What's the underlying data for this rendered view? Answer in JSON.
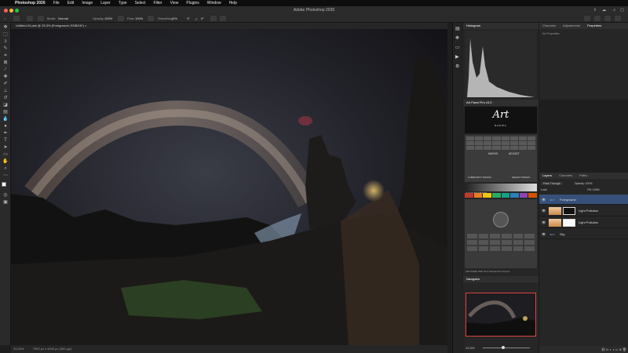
{
  "menubar": {
    "apple": "",
    "items": [
      "Photoshop 2026",
      "File",
      "Edit",
      "Image",
      "Layer",
      "Type",
      "Select",
      "Filter",
      "View",
      "Plugins",
      "Window",
      "Help"
    ]
  },
  "window": {
    "title": "Adobe Photoshop 2026",
    "traffic_colors": [
      "#ff5f57",
      "#febc2e",
      "#28c840"
    ]
  },
  "options_bar": {
    "mode_label": "Mode:",
    "mode_value": "Normal",
    "opacity_label": "Opacity:",
    "opacity_value": "100%",
    "flow_label": "Flow:",
    "flow_value": "100%",
    "smoothing_label": "Smoothing:",
    "smoothing_value": "0%",
    "angle_value": "0°"
  },
  "document": {
    "tab_label": "Untitled-24.psb @ 33.3% (Foreground, RGB/16*) ×",
    "status_zoom": "33.33%",
    "status_info": "7993 px x 4500 px (300 ppi)"
  },
  "panels": {
    "histogram": {
      "tab": "Histogram"
    },
    "top_right_tabs": [
      "Channels",
      "Adjustments",
      "Properties"
    ],
    "properties_label": "No Properties",
    "art_panel": {
      "title": "Art Panel Pro v3.0",
      "logo": "Art",
      "logo_sub": "PANEL",
      "sub_label_1": "MASKS",
      "sub_label_2": "ADJUST",
      "label_masks": "LUMINOSITY MASKS",
      "label_select": "SELECT MASKS",
      "numbers": "1 2 3 4 5 6 7 8 9 10",
      "footer": "ART PANEL PRO V3.0        Tutorials     Info Sources"
    },
    "navigator": {
      "tab": "Navigator",
      "zoom": "33.33%"
    },
    "layers": {
      "tabs": [
        "Layers",
        "Channels",
        "Paths"
      ],
      "blend": "Pass Through",
      "opacity_label": "Opacity:",
      "opacity": "100%",
      "lock_label": "Lock:",
      "fill_label": "Fill:",
      "fill": "100%",
      "items": [
        {
          "name": "Foreground",
          "type": "group"
        },
        {
          "name": "Light Pollution",
          "type": "layer"
        },
        {
          "name": "Light Pollution",
          "type": "layer"
        },
        {
          "name": "Sky",
          "type": "group"
        }
      ]
    }
  },
  "icons": {
    "tools": [
      "move-icon",
      "marquee-icon",
      "lasso-icon",
      "quick-select-icon",
      "crop-icon",
      "frame-icon",
      "eyedropper-icon",
      "healing-icon",
      "brush-icon",
      "stamp-icon",
      "history-brush-icon",
      "eraser-icon",
      "gradient-icon",
      "blur-icon",
      "dodge-icon",
      "pen-icon",
      "type-icon",
      "path-select-icon",
      "shape-icon",
      "hand-icon",
      "zoom-icon",
      "more-tools-icon"
    ]
  }
}
